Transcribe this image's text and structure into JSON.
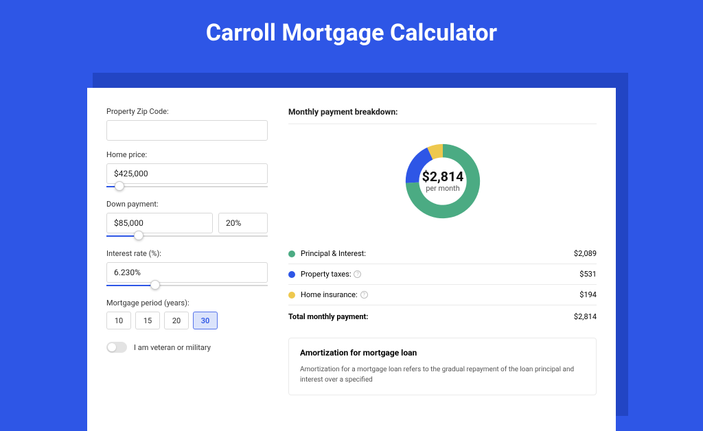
{
  "title": "Carroll Mortgage Calculator",
  "form": {
    "zip_label": "Property Zip Code:",
    "zip_value": "",
    "price_label": "Home price:",
    "price_value": "$425,000",
    "price_pct": 8,
    "down_label": "Down payment:",
    "down_value": "$85,000",
    "down_pct_value": "20%",
    "down_slider_pct": 20,
    "rate_label": "Interest rate (%):",
    "rate_value": "6.230%",
    "rate_slider_pct": 30,
    "period_label": "Mortgage period (years):",
    "periods": [
      "10",
      "15",
      "20",
      "30"
    ],
    "period_selected": "30",
    "veteran_label": "I am veteran or military",
    "veteran_on": false
  },
  "breakdown": {
    "heading": "Monthly payment breakdown:",
    "donut": {
      "center_amount": "$2,814",
      "center_sub": "per month"
    },
    "items": [
      {
        "color": "#4bab83",
        "label": "Principal & Interest:",
        "value": "$2,089",
        "help": false
      },
      {
        "color": "#2e56e6",
        "label": "Property taxes:",
        "value": "$531",
        "help": true
      },
      {
        "color": "#eec84e",
        "label": "Home insurance:",
        "value": "$194",
        "help": true
      }
    ],
    "total_label": "Total monthly payment:",
    "total_value": "$2,814"
  },
  "chart_data": {
    "type": "pie",
    "title": "Monthly payment breakdown",
    "series": [
      {
        "name": "Principal & Interest",
        "value": 2089,
        "color": "#4bab83"
      },
      {
        "name": "Property taxes",
        "value": 531,
        "color": "#2e56e6"
      },
      {
        "name": "Home insurance",
        "value": 194,
        "color": "#eec84e"
      }
    ],
    "total": 2814,
    "unit": "per month"
  },
  "amort": {
    "heading": "Amortization for mortgage loan",
    "text": "Amortization for a mortgage loan refers to the gradual repayment of the loan principal and interest over a specified"
  }
}
